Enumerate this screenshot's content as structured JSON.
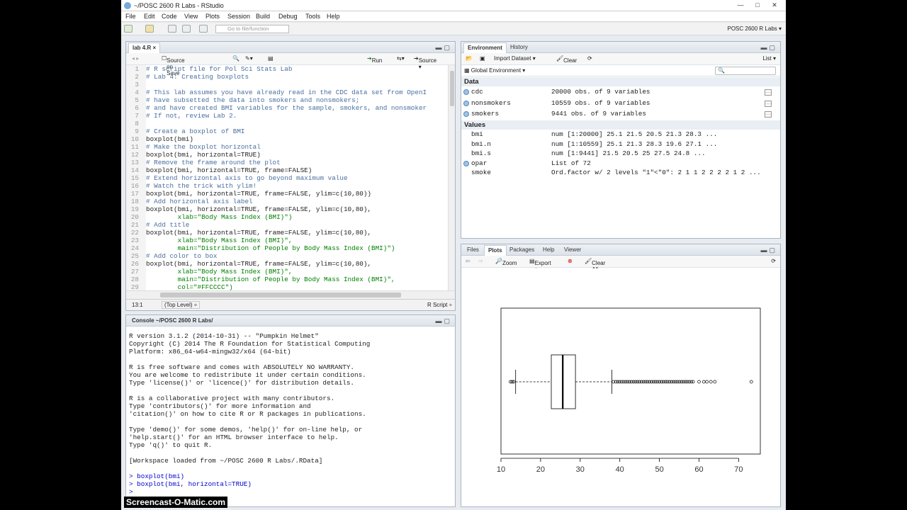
{
  "window": {
    "title": "~/POSC 2600 R Labs - RStudio",
    "controls": [
      "—",
      "□",
      "✕"
    ]
  },
  "menu": [
    "File",
    "Edit",
    "Code",
    "View",
    "Plots",
    "Session",
    "Build",
    "Debug",
    "Tools",
    "Help"
  ],
  "toolbar": {
    "goto_placeholder": "Go to file/function",
    "project": "POSC 2600 R Labs ▾"
  },
  "editor": {
    "tab": "lab 4.R ×",
    "source_on_save": "Source on Save",
    "run": "Run",
    "source": "Source ▾",
    "lines": [
      {
        "n": "1",
        "t": "# R script file for Pol Sci Stats Lab",
        "c": "cmt"
      },
      {
        "n": "2",
        "t": "# Lab 4: Creating boxplots",
        "c": "cmt"
      },
      {
        "n": "3",
        "t": "",
        "c": ""
      },
      {
        "n": "4",
        "t": "# This lab assumes you have already read in the CDC data set from OpenI",
        "c": "cmt"
      },
      {
        "n": "5",
        "t": "# have subsetted the data into smokers and nonsmokers;",
        "c": "cmt"
      },
      {
        "n": "6",
        "t": "# and have created BMI variables for the sample, smokers, and nonsmoker",
        "c": "cmt"
      },
      {
        "n": "7",
        "t": "# If not, review Lab 2.",
        "c": "cmt"
      },
      {
        "n": "8",
        "t": "",
        "c": ""
      },
      {
        "n": "9",
        "t": "# Create a boxplot of BMI",
        "c": "cmt"
      },
      {
        "n": "10",
        "t": "boxplot(bmi)",
        "c": ""
      },
      {
        "n": "11",
        "t": "# Make the boxplot horizontal",
        "c": "cmt"
      },
      {
        "n": "12",
        "t": "boxplot(bmi, horizontal=TRUE)",
        "c": ""
      },
      {
        "n": "13",
        "t": "# Remove the frame around the plot",
        "c": "cmt"
      },
      {
        "n": "14",
        "t": "boxplot(bmi, horizontal=TRUE, frame=FALSE)",
        "c": ""
      },
      {
        "n": "15",
        "t": "# Extend horizontal axis to go beyond maximum value",
        "c": "cmt"
      },
      {
        "n": "16",
        "t": "# Watch the trick with ylim!",
        "c": "cmt"
      },
      {
        "n": "17",
        "t": "boxplot(bmi, horizontal=TRUE, frame=FALSE, ylim=c(10,80))",
        "c": ""
      },
      {
        "n": "18",
        "t": "# Add horizontal axis label",
        "c": "cmt"
      },
      {
        "n": "19",
        "t": "boxplot(bmi, horizontal=TRUE, frame=FALSE, ylim=c(10,80),",
        "c": ""
      },
      {
        "n": "20",
        "t": "        xlab=\"Body Mass Index (BMI)\")",
        "c": "str"
      },
      {
        "n": "21",
        "t": "# Add title",
        "c": "cmt"
      },
      {
        "n": "22",
        "t": "boxplot(bmi, horizontal=TRUE, frame=FALSE, ylim=c(10,80),",
        "c": ""
      },
      {
        "n": "23",
        "t": "        xlab=\"Body Mass Index (BMI)\",",
        "c": "str"
      },
      {
        "n": "24",
        "t": "        main=\"Distribution of People by Body Mass Index (BMI)\")",
        "c": "str"
      },
      {
        "n": "25",
        "t": "# Add color to box",
        "c": "cmt"
      },
      {
        "n": "26",
        "t": "boxplot(bmi, horizontal=TRUE, frame=FALSE, ylim=c(10,80),",
        "c": ""
      },
      {
        "n": "27",
        "t": "        xlab=\"Body Mass Index (BMI)\",",
        "c": "str"
      },
      {
        "n": "28",
        "t": "        main=\"Distribution of People by Body Mass Index (BMI)\",",
        "c": "str"
      },
      {
        "n": "29",
        "t": "        col=\"#FFCCCC\")",
        "c": "str"
      },
      {
        "n": "30",
        "t": "",
        "c": ""
      },
      {
        "n": "31",
        "t": "",
        "c": ""
      }
    ],
    "status_pos": "13:1",
    "status_level": "(Top Level) ÷",
    "status_type": "R Script ÷"
  },
  "console": {
    "title": "Console ~/POSC 2600 R Labs/",
    "lines": [
      {
        "t": "R version 3.1.2 (2014-10-31) -- \"Pumpkin Helmet\"",
        "p": false
      },
      {
        "t": "Copyright (C) 2014 The R Foundation for Statistical Computing",
        "p": false
      },
      {
        "t": "Platform: x86_64-w64-mingw32/x64 (64-bit)",
        "p": false
      },
      {
        "t": "",
        "p": false
      },
      {
        "t": "R is free software and comes with ABSOLUTELY NO WARRANTY.",
        "p": false
      },
      {
        "t": "You are welcome to redistribute it under certain conditions.",
        "p": false
      },
      {
        "t": "Type 'license()' or 'licence()' for distribution details.",
        "p": false
      },
      {
        "t": "",
        "p": false
      },
      {
        "t": "R is a collaborative project with many contributors.",
        "p": false
      },
      {
        "t": "Type 'contributors()' for more information and",
        "p": false
      },
      {
        "t": "'citation()' on how to cite R or R packages in publications.",
        "p": false
      },
      {
        "t": "",
        "p": false
      },
      {
        "t": "Type 'demo()' for some demos, 'help()' for on-line help, or",
        "p": false
      },
      {
        "t": "'help.start()' for an HTML browser interface to help.",
        "p": false
      },
      {
        "t": "Type 'q()' to quit R.",
        "p": false
      },
      {
        "t": "",
        "p": false
      },
      {
        "t": "[Workspace loaded from ~/POSC 2600 R Labs/.RData]",
        "p": false
      },
      {
        "t": "",
        "p": false
      },
      {
        "t": "> boxplot(bmi)",
        "p": true
      },
      {
        "t": "> boxplot(bmi, horizontal=TRUE)",
        "p": true
      },
      {
        "t": "> ",
        "p": true
      }
    ]
  },
  "environment": {
    "tabs": [
      "Environment",
      "History"
    ],
    "import": "Import Dataset ▾",
    "clear": "Clear",
    "list": "List ▾",
    "scope": "Global Environment ▾",
    "data_header": "Data",
    "values_header": "Values",
    "data": [
      {
        "name": "cdc",
        "value": "20000 obs. of 9 variables"
      },
      {
        "name": "nonsmokers",
        "value": "10559 obs. of 9 variables"
      },
      {
        "name": "smokers",
        "value": "9441 obs. of 9 variables"
      }
    ],
    "values": [
      {
        "name": "bmi",
        "value": "num [1:20000] 25.1 21.5 20.5 21.3 28.3 ...",
        "bullet": false
      },
      {
        "name": "bmi.n",
        "value": "num [1:10559] 25.1 21.3 28.3 19.6 27.1 ...",
        "bullet": false
      },
      {
        "name": "bmi.s",
        "value": "num [1:9441] 21.5 20.5 25 27.5 24.8 ...",
        "bullet": false
      },
      {
        "name": "opar",
        "value": "List of 72",
        "bullet": true
      },
      {
        "name": "smoke",
        "value": "Ord.factor w/ 2 levels \"1\"<\"0\": 2 1 1 2 2 2 2 1 2 ...",
        "bullet": false
      }
    ]
  },
  "files": {
    "tabs": [
      "Files",
      "Plots",
      "Packages",
      "Help",
      "Viewer"
    ],
    "zoom": "Zoom",
    "export": "Export ▾",
    "clear_all": "Clear All"
  },
  "chart_data": {
    "type": "boxplot",
    "orientation": "horizontal",
    "frame": true,
    "xlim": [
      10,
      75
    ],
    "ticks": [
      "10",
      "20",
      "30",
      "40",
      "50",
      "60",
      "70"
    ],
    "stats": {
      "lower_whisker": 13.7,
      "q1": 22.7,
      "median": 25.6,
      "q3": 28.8,
      "upper_whisker": 38.0
    },
    "outliers": [
      12.4,
      12.8,
      13.2,
      38.4,
      39,
      39.5,
      40,
      40.5,
      41,
      41.5,
      42,
      42.5,
      43,
      43.5,
      44,
      44.5,
      45,
      45.5,
      46,
      46.5,
      47,
      47.5,
      48,
      48.5,
      49,
      49.5,
      50,
      50.5,
      51,
      51.5,
      52,
      52.5,
      53,
      53.5,
      54,
      54.5,
      55,
      55.5,
      56,
      56.5,
      57,
      57.5,
      58,
      58.5,
      60,
      61.2,
      62,
      63,
      64,
      73.2
    ]
  },
  "watermark": "Screencast-O-Matic.com"
}
